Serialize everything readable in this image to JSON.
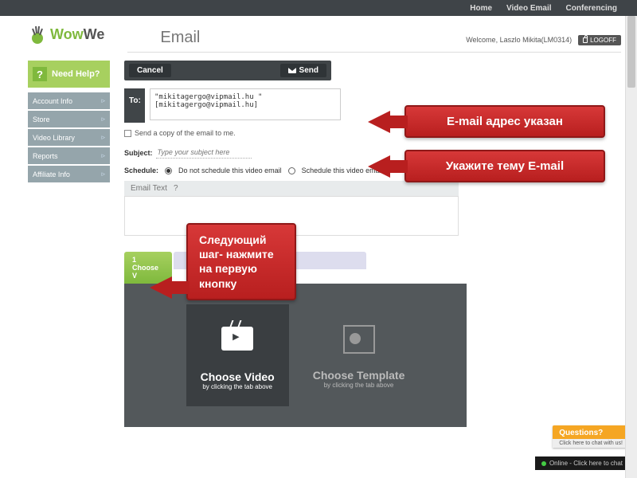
{
  "nav": {
    "home": "Home",
    "video_email": "Video Email",
    "conferencing": "Conferencing"
  },
  "logo": {
    "part1": "Wow",
    "part2": "We"
  },
  "page": {
    "title": "Email"
  },
  "welcome": {
    "text": "Welcome, Laszlo Mikita(LM0314)",
    "logoff": "LOGOFF"
  },
  "sidebar": {
    "help_label": "Need Help?",
    "help_q": "?",
    "items": [
      {
        "label": "Account Info"
      },
      {
        "label": "Store"
      },
      {
        "label": "Video Library"
      },
      {
        "label": "Reports"
      },
      {
        "label": "Affiliate Info"
      }
    ]
  },
  "actions": {
    "cancel": "Cancel",
    "send": "Send"
  },
  "form": {
    "to_label": "To:",
    "to_value": "\"mikitagergo@vipmail.hu \"[mikitagergo@vipmail.hu]",
    "send_copy": "Send a copy of the email to me.",
    "subject_label": "Subject:",
    "subject_placeholder": "Type your subject here",
    "schedule_label": "Schedule:",
    "schedule_opt1": "Do not schedule this video email",
    "schedule_opt2": "Schedule this video email",
    "email_text_tab": "Email Text",
    "qmark": "?"
  },
  "steps": {
    "tab1": "1 Choose V"
  },
  "choose": {
    "video": {
      "title": "Choose Video",
      "sub": "by clicking the tab above"
    },
    "template": {
      "title": "Choose Template",
      "sub": "by clicking the tab above"
    }
  },
  "callouts": {
    "c1": "E-mail адрес указан",
    "c2": "Укажите тему E-mail",
    "c3": "Следующий шаг- нажмите на первую кнопку"
  },
  "widgets": {
    "questions": "Questions?",
    "questions_sub": "Click here to chat with us!",
    "chat": "Online - Click here to chat"
  }
}
